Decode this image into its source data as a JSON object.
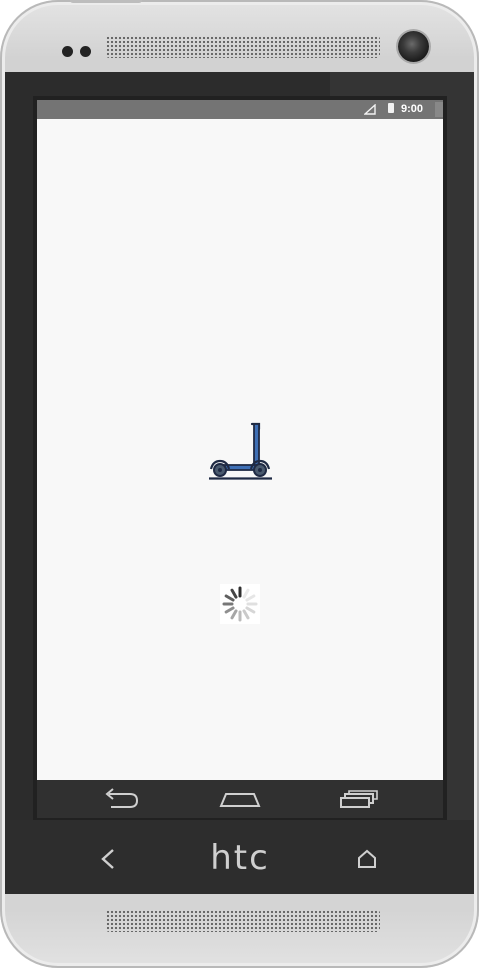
{
  "device": {
    "brand_label": "htc"
  },
  "status_bar": {
    "time": "9:00",
    "signal_icon": "cellular-signal-icon",
    "battery_icon": "battery-icon"
  },
  "splash": {
    "logo_icon": "kick-scooter-icon",
    "loading_indicator": "spinner-icon"
  },
  "nav_bar": {
    "back_icon": "back-arrow-icon",
    "home_icon": "home-icon",
    "recents_icon": "recent-apps-icon"
  },
  "hardware_keys": {
    "back_icon": "chevron-left-icon",
    "home_icon": "house-icon"
  },
  "colors": {
    "scooter_stroke": "#1f2a44",
    "scooter_fill": "#3e6fb5",
    "screen_background": "#f8f8f8",
    "nav_bar": "#303030"
  }
}
